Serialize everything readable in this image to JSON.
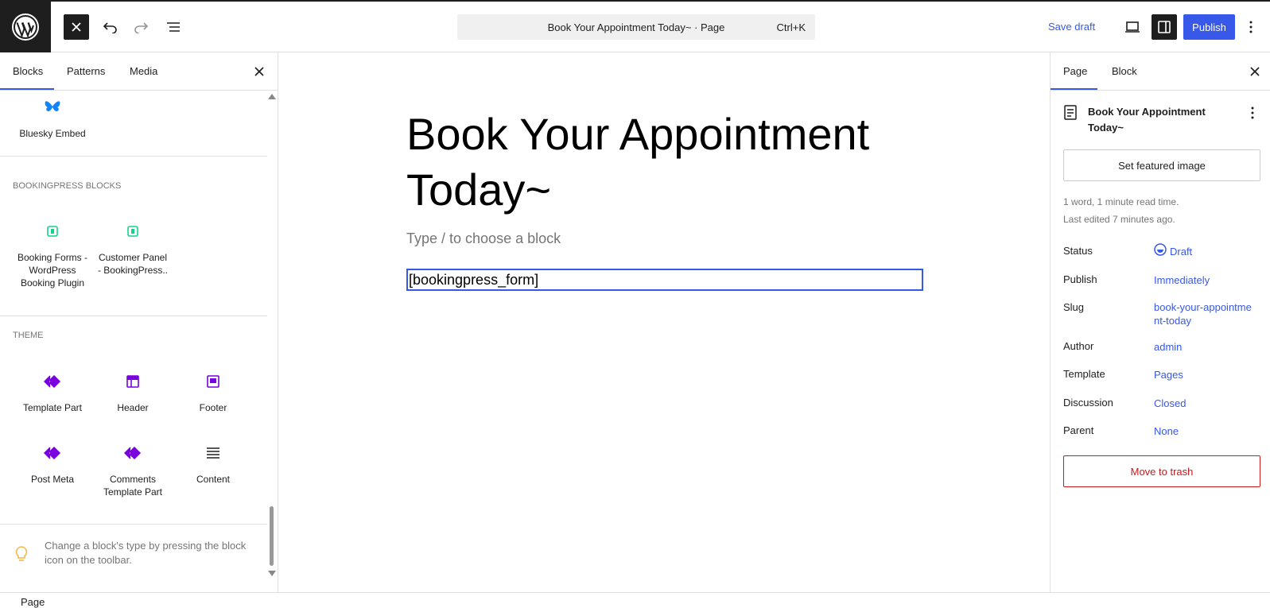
{
  "topbar": {
    "command_bar_title": "Book Your Appointment Today~ · Page",
    "command_bar_shortcut": "Ctrl+K",
    "save_draft_label": "Save draft",
    "publish_label": "Publish"
  },
  "inserter": {
    "tabs": [
      {
        "label": "Blocks"
      },
      {
        "label": "Patterns"
      },
      {
        "label": "Media"
      }
    ],
    "embed_blocks": [
      {
        "label": "Bluesky Embed",
        "icon": "bluesky-icon"
      }
    ],
    "categories": [
      {
        "title": "BOOKINGPRESS BLOCKS",
        "blocks": [
          {
            "label": "Booking Forms - WordPress Booking Plugin",
            "icon": "bookingpress-icon"
          },
          {
            "label": "Customer Panel - BookingPress..",
            "icon": "bookingpress-icon"
          }
        ]
      },
      {
        "title": "THEME",
        "blocks": [
          {
            "label": "Template Part",
            "icon": "diamond-icon"
          },
          {
            "label": "Header",
            "icon": "header-icon"
          },
          {
            "label": "Footer",
            "icon": "footer-icon"
          },
          {
            "label": "Post Meta",
            "icon": "diamond-icon"
          },
          {
            "label": "Comments Template Part",
            "icon": "diamond-icon"
          },
          {
            "label": "Content",
            "icon": "lines-icon"
          }
        ]
      }
    ],
    "tip": "Change a block's type by pressing the block icon on the toolbar."
  },
  "editor": {
    "title": "Book Your Appointment Today~",
    "placeholder": "Type / to choose a block",
    "shortcode": "[bookingpress_form]"
  },
  "sidebar": {
    "tabs": [
      {
        "label": "Page"
      },
      {
        "label": "Block"
      }
    ],
    "page_title": "Book Your Appointment Today~",
    "featured_image_label": "Set featured image",
    "word_count": "1 word, 1 minute read time.",
    "last_edited": "Last edited 7 minutes ago.",
    "rows": [
      {
        "label": "Status",
        "value": "Draft"
      },
      {
        "label": "Publish",
        "value": "Immediately"
      },
      {
        "label": "Slug",
        "value": "book-your-appointment-today"
      },
      {
        "label": "Author",
        "value": "admin"
      },
      {
        "label": "Template",
        "value": "Pages"
      },
      {
        "label": "Discussion",
        "value": "Closed"
      },
      {
        "label": "Parent",
        "value": "None"
      }
    ],
    "trash_label": "Move to trash"
  },
  "footer": {
    "breadcrumb": "Page"
  },
  "colors": {
    "accent": "#3858e9",
    "dark": "#1e1e1e",
    "danger": "#cc1818",
    "bookingpress": "#12d488",
    "theme_icon": "#7a00df"
  }
}
